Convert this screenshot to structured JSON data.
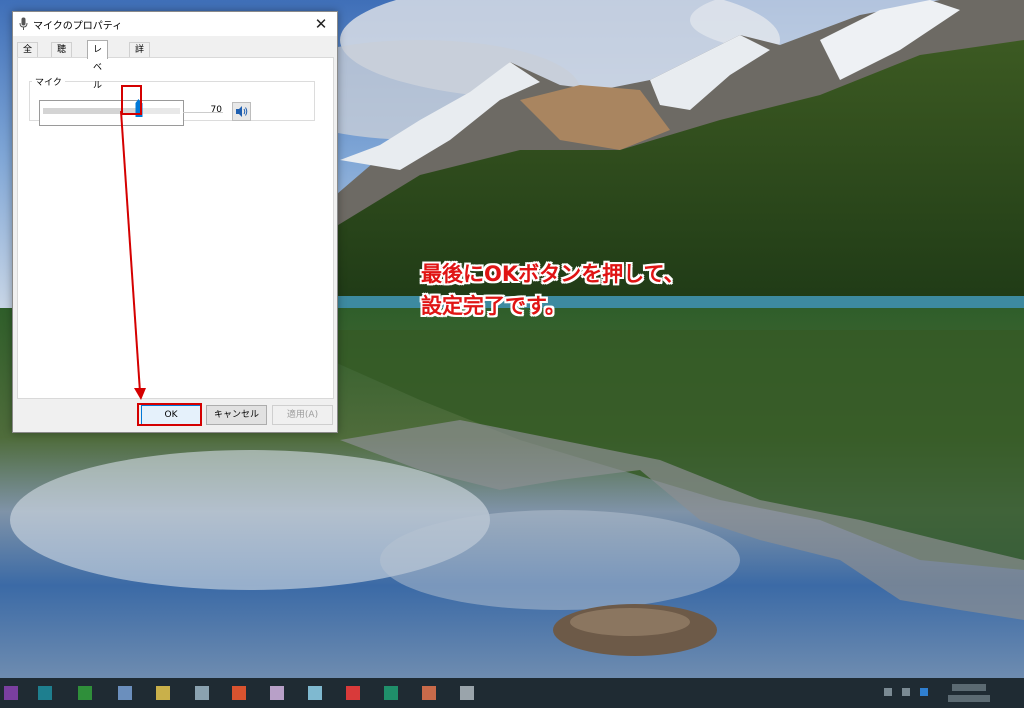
{
  "dialog": {
    "title": "マイクのプロパティ",
    "close_label": "✕",
    "tabs": [
      {
        "label": "全般",
        "active": false
      },
      {
        "label": "聴く",
        "active": false
      },
      {
        "label": "レベル",
        "active": true
      },
      {
        "label": "詳細",
        "active": false
      }
    ],
    "level_group": {
      "label": "マイク",
      "level_value": "70",
      "level_fraction": 0.7,
      "speaker_icon": "speaker-volume-icon"
    },
    "buttons": {
      "ok": "OK",
      "cancel": "キャンセル",
      "apply": "適用(A)"
    }
  },
  "annotation": {
    "line1": "最後にOKボタンを押して、",
    "line2": "設定完了です。",
    "color": "#e01414"
  },
  "taskbar": {
    "icons": [
      "start-icon",
      "app-icon",
      "app-icon",
      "app-icon",
      "app-icon",
      "app-icon",
      "app-icon",
      "app-icon",
      "app-icon",
      "app-icon",
      "app-icon",
      "app-icon",
      "app-icon"
    ],
    "background": "#1f2b33"
  }
}
